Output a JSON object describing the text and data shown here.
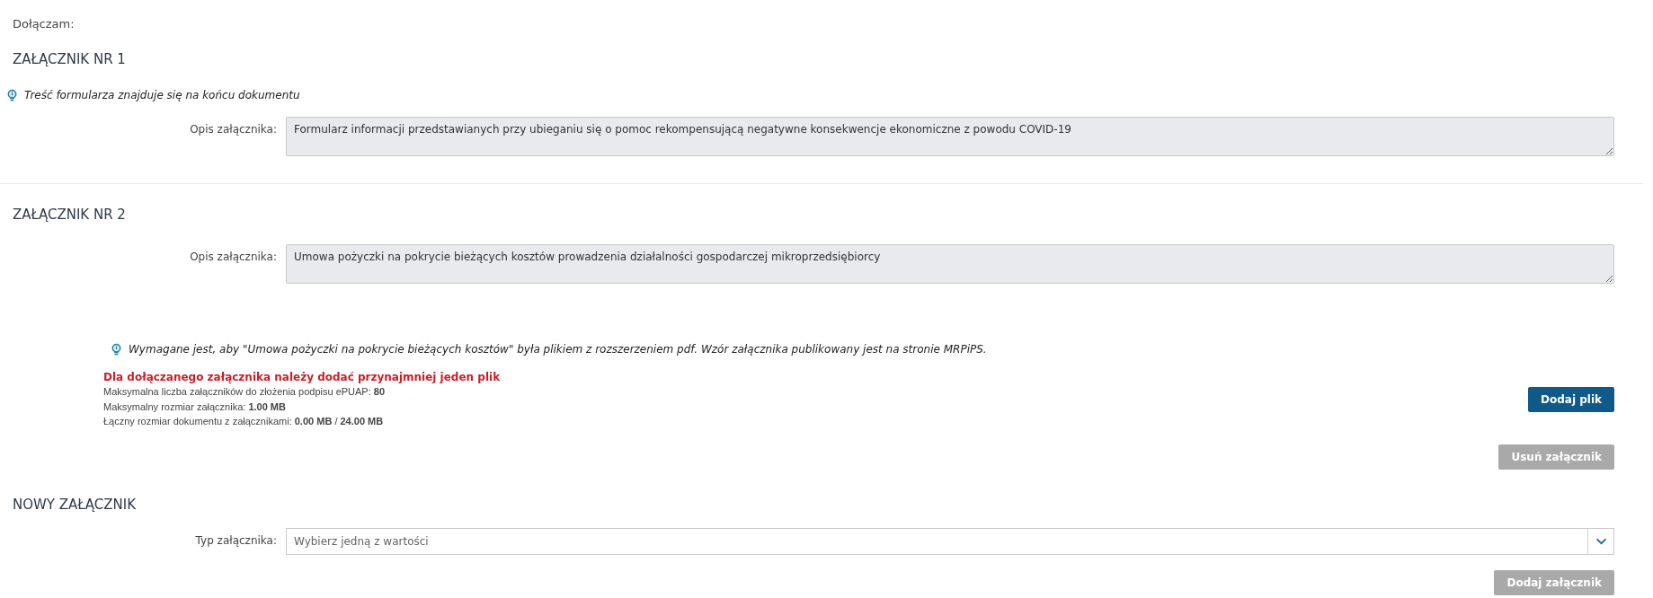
{
  "intro": "Dołączam:",
  "attachments": [
    {
      "title": "ZAŁĄCZNIK NR 1",
      "hint": "Treść formularza znajduje się na końcu dokumentu",
      "description_label": "Opis załącznika:",
      "description": "Formularz informacji przedstawianych przy ubieganiu się o pomoc rekompensującą negatywne konsekwencje ekonomiczne z powodu COVID-19"
    },
    {
      "title": "ZAŁĄCZNIK NR 2",
      "description_label": "Opis załącznika:",
      "description": "Umowa pożyczki na pokrycie bieżących kosztów prowadzenia działalności gospodarczej mikroprzedsiębiorcy",
      "requirement_hint": "Wymagane jest, aby \"Umowa pożyczki na pokrycie bieżących kosztów\" była plikiem z rozszerzeniem pdf. Wzór załącznika publikowany jest na stronie MRPiPS.",
      "error": "Dla dołączanego załącznika należy dodać przynajmniej jeden plik",
      "limits": [
        "Maksymalna liczba załączników do złożenia podpisu ePUAP: **80**",
        "Maksymalny rozmiar załącznika: **1.00 MB**",
        "Łączny rozmiar dokumentu z załącznikami: **0.00 MB** / **24.00 MB**"
      ],
      "add_file_button": {
        "label": "Dodaj plik",
        "disabled": false
      },
      "remove_button": {
        "label": "Usuń załącznik",
        "disabled": true
      }
    }
  ],
  "new_attachment": {
    "title": "NOWY ZAŁĄCZNIK",
    "type_label": "Typ załącznika:",
    "type_placeholder": "Wybierz jedną z wartości",
    "add_button": {
      "label": "Dodaj załącznik",
      "disabled": true
    }
  }
}
